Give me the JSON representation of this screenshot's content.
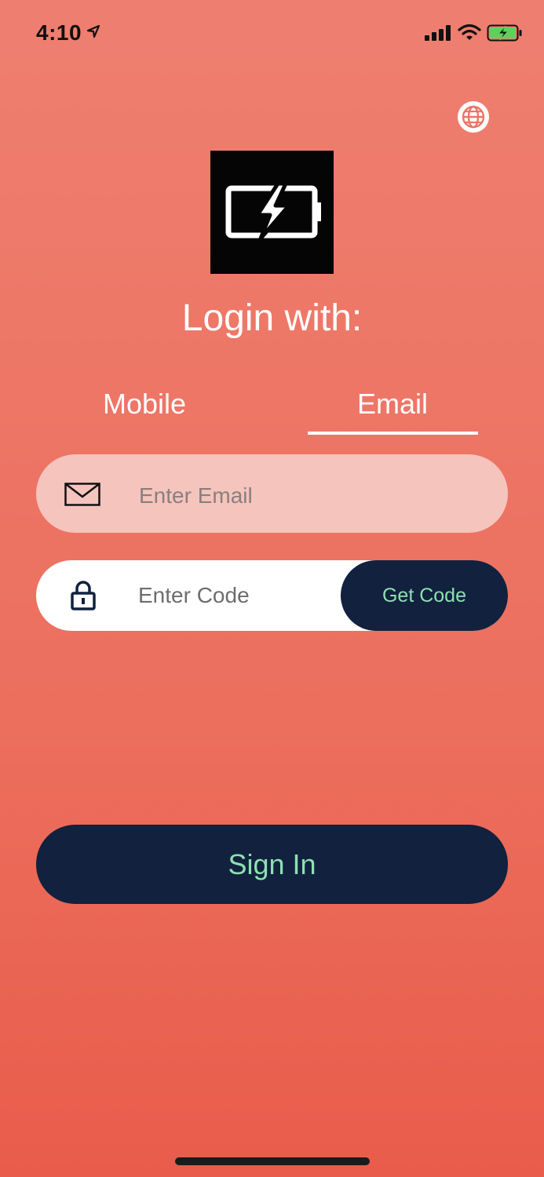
{
  "status_bar": {
    "time": "4:10",
    "icons": [
      "location-arrow-icon",
      "cellular-signal-icon",
      "wifi-icon",
      "battery-charging-icon"
    ]
  },
  "header": {
    "language_icon": "globe-icon"
  },
  "logo": {
    "icon": "battery-charging-icon"
  },
  "title": "Login with:",
  "tabs": [
    {
      "label": "Mobile",
      "active": false
    },
    {
      "label": "Email",
      "active": true
    }
  ],
  "email_field": {
    "icon": "mail-icon",
    "placeholder": "Enter Email",
    "value": ""
  },
  "code_field": {
    "icon": "lock-icon",
    "placeholder": "Enter Code",
    "value": "",
    "button_label": "Get Code"
  },
  "sign_in": {
    "label": "Sign In"
  },
  "colors": {
    "background_top": "#ee7f70",
    "background_bottom": "#e95c4b",
    "button_bg": "#11213e",
    "button_text": "#8ee0b0",
    "email_field_bg": "#f5c4bd"
  }
}
